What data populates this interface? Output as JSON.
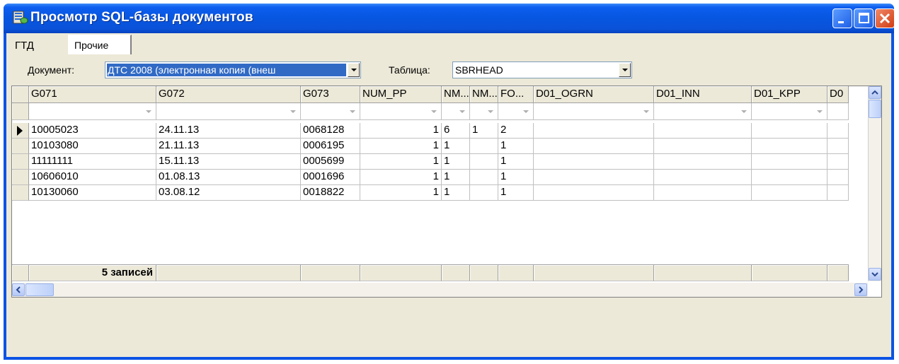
{
  "window": {
    "title": "Просмотр SQL-базы документов",
    "icon": "database-icon"
  },
  "tabs": [
    {
      "label": "ГТД"
    },
    {
      "label": "Прочие"
    }
  ],
  "filters": {
    "document_label": "Документ:",
    "document_value": "ДТС 2008 (электронная копия (внеш",
    "table_label": "Таблица:",
    "table_value": "SBRHEAD"
  },
  "grid": {
    "columns": [
      "G071",
      "G072",
      "G073",
      "NUM_PP",
      "NM...",
      "NM...",
      "FO...",
      "D01_OGRN",
      "D01_INN",
      "D01_KPP",
      "D0"
    ],
    "rows": [
      [
        "10005023",
        "24.11.13",
        "0068128",
        "1",
        "6",
        "1",
        "2",
        "",
        "",
        "",
        ""
      ],
      [
        "10103080",
        "21.11.13",
        "0006195",
        "1",
        "1",
        "",
        "1",
        "",
        "",
        "",
        ""
      ],
      [
        "11111111",
        "15.11.13",
        "0005699",
        "1",
        "1",
        "",
        "1",
        "",
        "",
        "",
        ""
      ],
      [
        "10606010",
        "01.08.13",
        "0001696",
        "1",
        "1",
        "",
        "1",
        "",
        "",
        "",
        ""
      ],
      [
        "10130060",
        "03.08.12",
        "0018822",
        "1",
        "1",
        "",
        "1",
        "",
        "",
        "",
        ""
      ]
    ],
    "footer": "5 записей",
    "current_row": 0
  }
}
